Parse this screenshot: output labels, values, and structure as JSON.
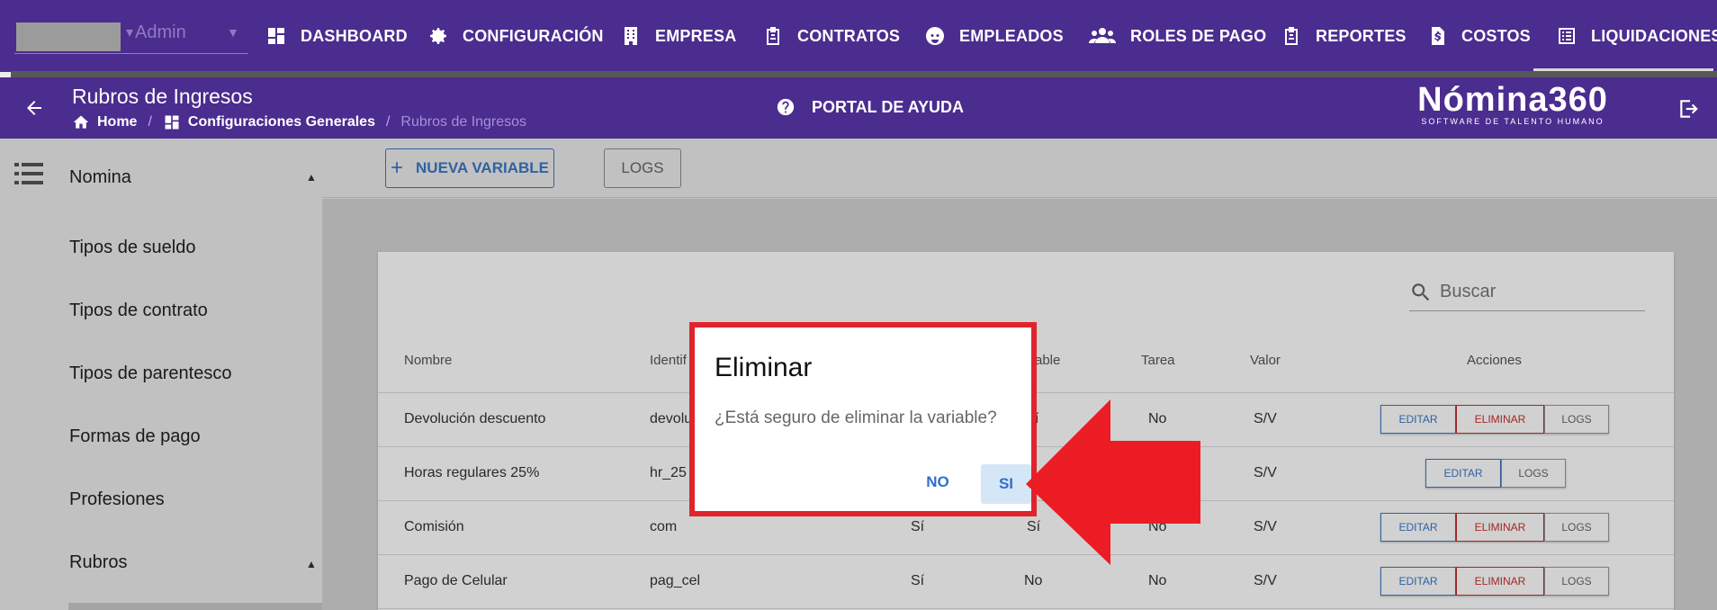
{
  "user": {
    "name": "Admin"
  },
  "nav": {
    "items": [
      {
        "label": "DASHBOARD",
        "icon": "dashboard-icon"
      },
      {
        "label": "CONFIGURACIÓN",
        "icon": "gear-icon"
      },
      {
        "label": "EMPRESA",
        "icon": "building-icon"
      },
      {
        "label": "CONTRATOS",
        "icon": "clipboard-icon"
      },
      {
        "label": "EMPLEADOS",
        "icon": "face-icon"
      },
      {
        "label": "ROLES DE PAGO",
        "icon": "people-icon"
      },
      {
        "label": "REPORTES",
        "icon": "clipboard-icon"
      },
      {
        "label": "COSTOS",
        "icon": "dollar-file-icon"
      },
      {
        "label": "LIQUIDACIONES",
        "icon": "list-icon"
      }
    ]
  },
  "header": {
    "title": "Rubros de Ingresos",
    "breadcrumb": [
      "Home",
      "Configuraciones Generales",
      "Rubros de Ingresos"
    ],
    "help": "PORTAL DE AYUDA",
    "brand": "Nómina360",
    "brand_tagline": "SOFTWARE DE TALENTO HUMANO"
  },
  "sidebar": {
    "section": "Nomina",
    "items": [
      "Tipos de sueldo",
      "Tipos de contrato",
      "Tipos de parentesco",
      "Formas de pago",
      "Profesiones",
      "Rubros"
    ]
  },
  "toolbar": {
    "new_label": "NUEVA VARIABLE",
    "logs_label": "LOGS"
  },
  "search": {
    "placeholder": "Buscar"
  },
  "table": {
    "headers": [
      "Nombre",
      "Identif",
      "able",
      "Tarea",
      "Valor",
      "Acciones"
    ],
    "rows": [
      {
        "nombre": "Devolución descuento",
        "identificador": "devolu",
        "col3": "",
        "col4": "í",
        "tarea": "No",
        "valor": "S/V",
        "acciones": [
          "EDITAR",
          "ELIMINAR",
          "LOGS"
        ]
      },
      {
        "nombre": "Horas regulares 25%",
        "identificador": "hr_25",
        "col3": "",
        "col4": "",
        "tarea": "",
        "valor": "S/V",
        "acciones": [
          "EDITAR",
          "LOGS"
        ]
      },
      {
        "nombre": "Comisión",
        "identificador": "com",
        "col3": "Sí",
        "col4": "Sí",
        "tarea": "No",
        "valor": "S/V",
        "acciones": [
          "EDITAR",
          "ELIMINAR",
          "LOGS"
        ]
      },
      {
        "nombre": "Pago de Celular",
        "identificador": "pag_cel",
        "col3": "Sí",
        "col4": "No",
        "tarea": "No",
        "valor": "S/V",
        "acciones": [
          "EDITAR",
          "ELIMINAR",
          "LOGS"
        ]
      }
    ]
  },
  "dialog": {
    "title": "Eliminar",
    "message": "¿Está seguro de eliminar la variable?",
    "no_label": "NO",
    "yes_label": "SI"
  },
  "colors": {
    "nav_bg": "#4b2c8f",
    "dialog_border": "#e0242b",
    "primary_blue": "#3a78c9",
    "danger_red": "#c9302c"
  }
}
